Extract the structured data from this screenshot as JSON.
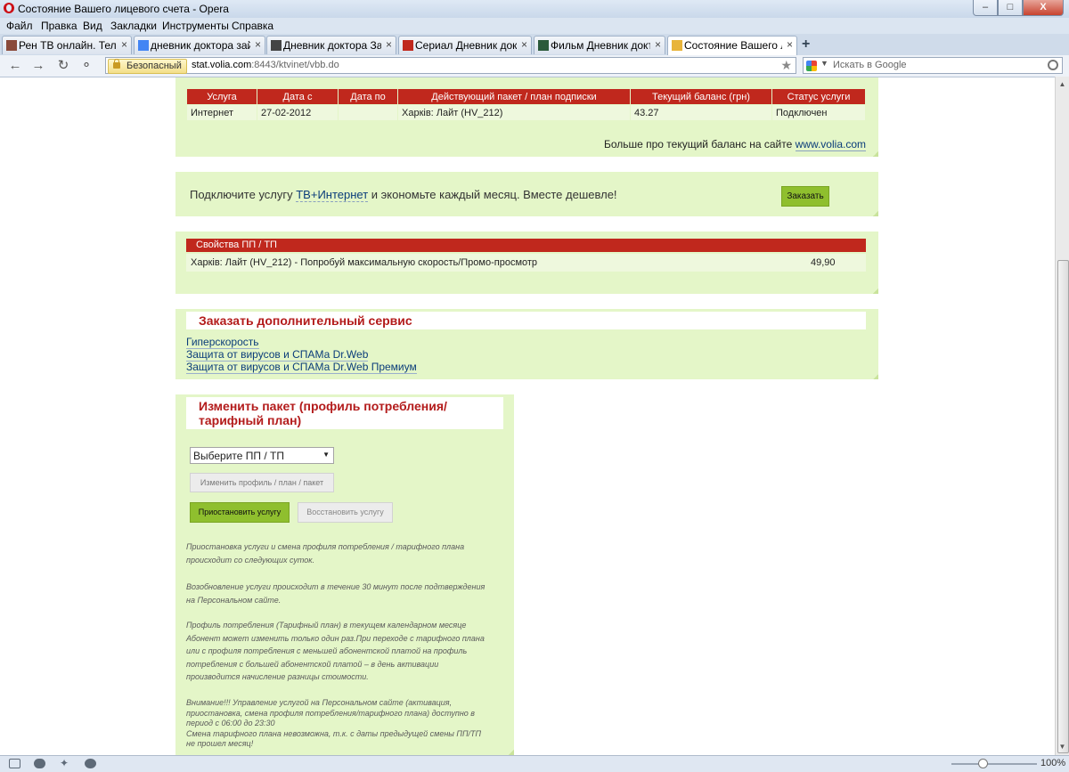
{
  "window": {
    "title": "Состояние Вашего лицевого счета - Opera",
    "buttons": {
      "minimize": "–",
      "maximize": "□",
      "close": "X"
    }
  },
  "menu": [
    "Файл",
    "Правка",
    "Вид",
    "Закладки",
    "Инструменты",
    "Справка"
  ],
  "tabs": [
    {
      "label": "Рен ТВ онлайн. Телев"
    },
    {
      "label": "дневник доктора зайц"
    },
    {
      "label": "Дневник доктора Зай"
    },
    {
      "label": "Сериал Дневник докт"
    },
    {
      "label": "Фильм Дневник докто"
    },
    {
      "label": "Состояние Вашего ли"
    }
  ],
  "tab_icon_colors": [
    "#8a4a3a",
    "#4285f4",
    "#444444",
    "#c0281d",
    "#2b5a3a",
    "#e8b43a"
  ],
  "new_tab": "+",
  "tab_close": "×",
  "nav": {
    "security_label": "Безопасный",
    "url_domain": "stat.volia.com",
    "url_rest": ":8443/ktvinet/vbb.do",
    "search_placeholder": "Искать в Google"
  },
  "services": {
    "headers": [
      "Услуга",
      "Дата с",
      "Дата по",
      "Действующий пакет / план подписки",
      "Текущий баланс (грн)",
      "Статус услуги"
    ],
    "rows": [
      [
        "Интернет",
        "27-02-2012",
        "",
        "Харків: Лайт (HV_212)",
        "43.27",
        "Подключен"
      ]
    ],
    "more_text": "Больше про текущий баланс на сайте ",
    "more_link": "www.volia.com"
  },
  "promo": {
    "text_before": "Подключите услугу ",
    "link": "ТВ+Интернет",
    "text_after": " и экономьте каждый месяц. Вместе дешевле!",
    "button": "Заказать"
  },
  "properties": {
    "header": "Свойства ПП / ТП",
    "name": "Харків: Лайт (HV_212) - Попробуй максимальную скорость/Промо-просмотр",
    "value": "49,90"
  },
  "extra": {
    "title": "Заказать дополнительный сервис",
    "links": [
      "Гиперскорость",
      "Защита от вирусов и СПАМа Dr.Web",
      "Защита от вирусов и СПАМа Dr.Web Премиум"
    ]
  },
  "change": {
    "title_line1": "Изменить пакет (профиль потребления/",
    "title_line2": "тарифный план)",
    "select_value": "Выберите ПП / ТП",
    "change_button": "Изменить  профиль / план / пакет",
    "suspend_button": "Приостановить услугу",
    "restore_button": "Восстановить услугу",
    "notes": [
      [
        "Приостановка услуги и смена профиля потребления / тарифного плана",
        "происходит со следующих суток."
      ],
      [
        "Возобновление услуги происходит в течение 30 минут после подтверждения",
        "на Персональном сайте."
      ],
      [
        "Профиль потребления (Тарифный план) в текущем календарном месяце",
        "Абонент может изменить только один раз.При переходе с тарифного плана",
        "или с профиля потребления с меньшей абонентской платой на профиль",
        "потребления с большей абонентской платой – в день активации",
        "производится начисление разницы стоимости."
      ],
      [
        "Внимание!!! Управление услугой на Персональном сайте (активация,",
        "приостановка, смена профиля потребления/тарифного плана) доступно в",
        "период с 06:00 до 23:30",
        "Смена тарифного плана невозможна, т.к. с даты предыдущей смены ПП/ТП",
        "не прошел месяц!"
      ]
    ]
  },
  "status": {
    "zoom": "100%"
  },
  "colors": {
    "panel": "#e4f6c8",
    "header_red": "#c0281d",
    "button_green": "#8fbf2e",
    "link": "#0b3d7a",
    "section_title": "#b31b1b"
  }
}
